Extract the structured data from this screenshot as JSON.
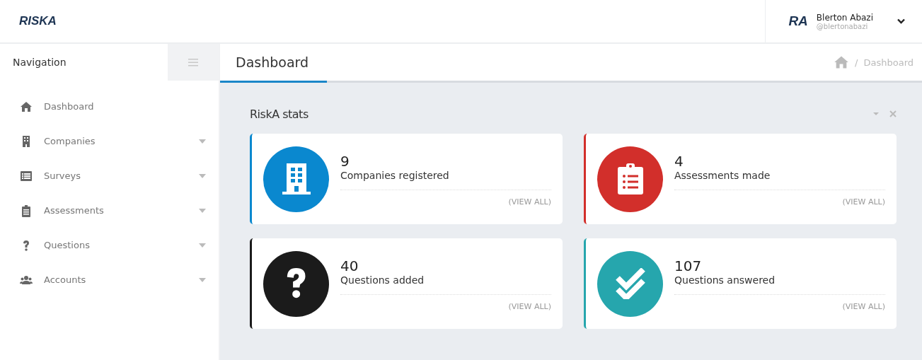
{
  "header": {
    "logo": "RISKA",
    "user": {
      "initials": "RA",
      "name": "Blerton Abazi",
      "handle": "@blertonabazi"
    }
  },
  "sidebar": {
    "title": "Navigation",
    "items": [
      {
        "label": "Dashboard",
        "has_submenu": false
      },
      {
        "label": "Companies",
        "has_submenu": true
      },
      {
        "label": "Surveys",
        "has_submenu": true
      },
      {
        "label": "Assessments",
        "has_submenu": true
      },
      {
        "label": "Questions",
        "has_submenu": true
      },
      {
        "label": "Accounts",
        "has_submenu": true
      }
    ]
  },
  "page": {
    "title": "Dashboard",
    "breadcrumb": {
      "separator": "/",
      "items": [
        "Dashboard"
      ]
    }
  },
  "panel": {
    "title": "RiskA stats",
    "cards": [
      {
        "count": "9",
        "label": "Companies registered",
        "link": "(VIEW ALL)",
        "color": "#0a88cf"
      },
      {
        "count": "4",
        "label": "Assessments made",
        "link": "(VIEW ALL)",
        "color": "#d22f2b"
      },
      {
        "count": "40",
        "label": "Questions added",
        "link": "(VIEW ALL)",
        "color": "#1b1b1b"
      },
      {
        "count": "107",
        "label": "Questions answered",
        "link": "(VIEW ALL)",
        "color": "#26a6ad"
      }
    ]
  }
}
